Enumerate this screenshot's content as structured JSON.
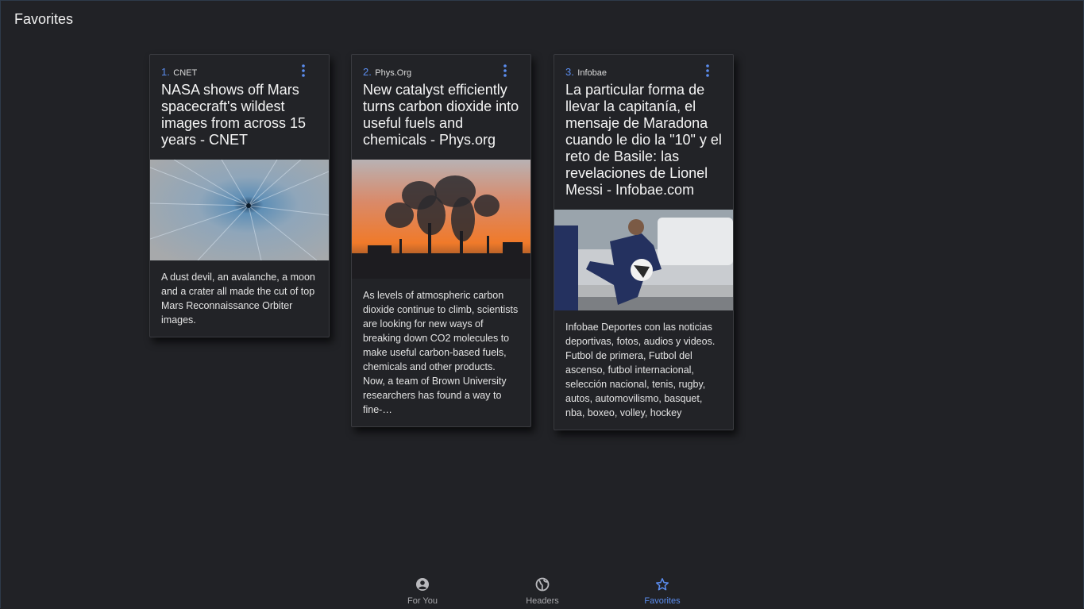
{
  "header": {
    "title": "Favorites"
  },
  "colors": {
    "accent": "#5b8def",
    "background": "#212226",
    "card": "#222327"
  },
  "cards": [
    {
      "rank": "1.",
      "source": "CNET",
      "title": "NASA shows off Mars spacecraft's wildest images from across 15 years - CNET",
      "description": "A dust devil, an avalanche, a moon and a crater all made the cut of top Mars Reconnaissance Orbiter images.",
      "image": "mars-crater-photo"
    },
    {
      "rank": "2.",
      "source": "Phys.Org",
      "title": "New catalyst efficiently turns carbon dioxide into useful fuels and chemicals - Phys.org",
      "description": "As levels of atmospheric carbon dioxide continue to climb, scientists are looking for new ways of breaking down CO2 molecules to make useful carbon-based fuels, chemicals and other products. Now, a team of Brown University researchers has found a way to fine-…",
      "image": "smokestacks-sunset-photo"
    },
    {
      "rank": "3.",
      "source": "Infobae",
      "title": "La particular forma de llevar la capitanía, el mensaje de Maradona cuando le dio la \"10\" y el reto de Basile: las revelaciones de Lionel Messi - Infobae.com",
      "description": "Infobae Deportes con las noticias deportivas, fotos, audios y videos. Futbol de primera, Futbol del ascenso, futbol internacional, selección nacional, tenis, rugby, autos, automovilismo, basquet, nba, boxeo, volley, hockey",
      "image": "soccer-player-photo"
    }
  ],
  "nav": {
    "items": [
      {
        "label": "For You",
        "icon": "account-circle-icon"
      },
      {
        "label": "Headers",
        "icon": "globe-icon"
      },
      {
        "label": "Favorites",
        "icon": "star-outline-icon",
        "active": true
      }
    ]
  }
}
